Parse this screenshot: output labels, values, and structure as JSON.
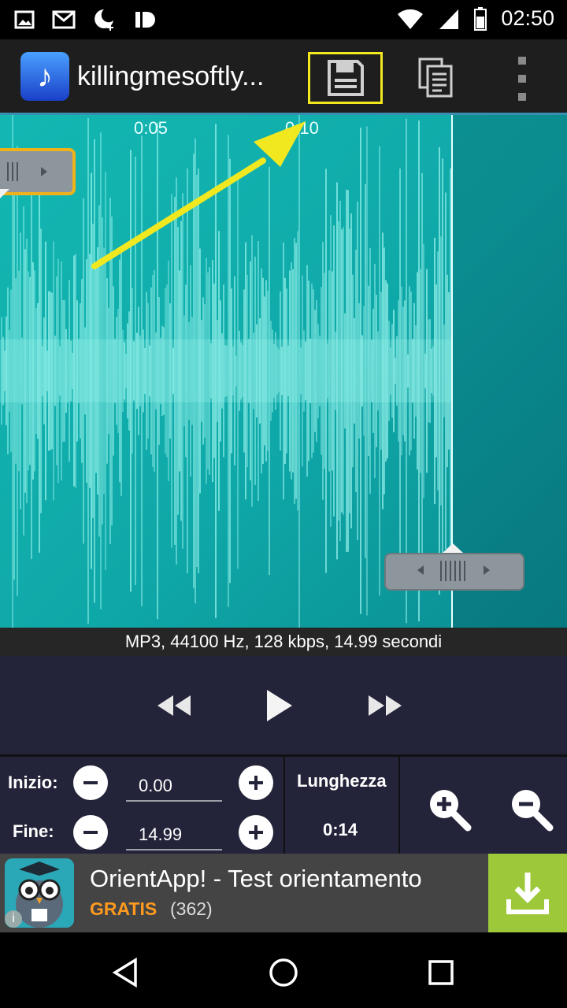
{
  "status_bar": {
    "time": "02:50"
  },
  "action_bar": {
    "title": "killingmesoftly..."
  },
  "waveform": {
    "tick_labels": [
      "0:05",
      "0:10"
    ]
  },
  "info_line": "MP3, 44100 Hz, 128 kbps, 14.99 secondi",
  "editor": {
    "start_label": "Inizio:",
    "start_value": "0.00",
    "end_label": "Fine:",
    "end_value": "14.99",
    "length_label": "Lunghezza",
    "length_value": "0:14"
  },
  "ad": {
    "title": "OrientApp! - Test orientamento",
    "price_label": "GRATIS",
    "rating_count": "(362)"
  },
  "colors": {
    "waveform_bg": "#13b7b2",
    "waveform_bars": "#9ff7f0",
    "highlight": "#f2e820",
    "control_bg": "#23233a",
    "ad_accent": "#9cc83a"
  }
}
